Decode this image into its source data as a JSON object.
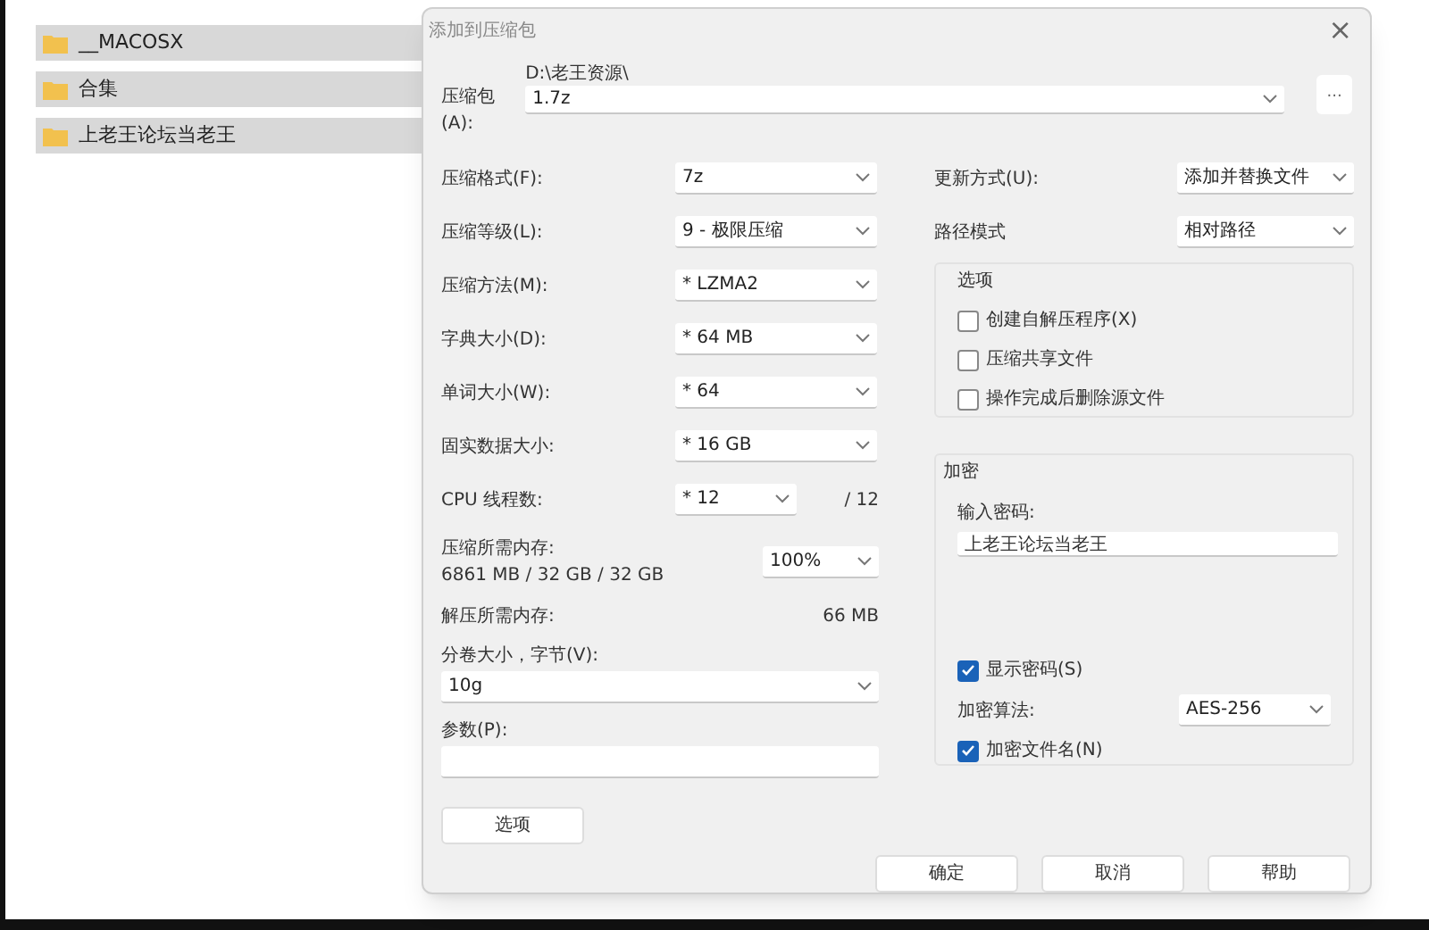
{
  "explorer": {
    "items": [
      {
        "name": "__MACOSX"
      },
      {
        "name": "合集"
      },
      {
        "name": "上老王论坛当老王"
      }
    ]
  },
  "window": {
    "title": "添加到压缩包",
    "close": "×"
  },
  "archive": {
    "label": "压缩包(A):",
    "path": "D:\\老王资源\\",
    "value": "1.7z",
    "browse": "..."
  },
  "settings": [
    {
      "label": "压缩格式(F):",
      "value": "7z"
    },
    {
      "label": "压缩等级(L):",
      "value": "9 - 极限压缩"
    },
    {
      "label": "压缩方法(M):",
      "value": "* LZMA2"
    },
    {
      "label": "字典大小(D):",
      "value": "* 64 MB"
    },
    {
      "label": "单词大小(W):",
      "value": "* 64"
    },
    {
      "label": "固实数据大小:",
      "value": "* 16 GB"
    },
    {
      "label": "CPU 线程数:",
      "value": "* 12",
      "suffix": "/ 12"
    }
  ],
  "memory": {
    "label": "压缩所需内存:",
    "detail": "6861 MB / 32 GB / 32 GB",
    "value": "100%"
  },
  "decompress": {
    "label": "解压所需内存:",
    "value": "66 MB"
  },
  "volume": {
    "label": "分卷大小，字节(V):",
    "value": "10g"
  },
  "params": {
    "label": "参数(P):"
  },
  "options_button": "选项",
  "update": {
    "label": "更新方式(U):",
    "value": "添加并替换文件"
  },
  "path_mode": {
    "label": "路径模式",
    "value": "相对路径"
  },
  "options": {
    "title": "选项",
    "checkboxes": [
      {
        "label": "创建自解压程序(X)",
        "checked": false
      },
      {
        "label": "压缩共享文件",
        "checked": false
      },
      {
        "label": "操作完成后删除源文件",
        "checked": false
      }
    ]
  },
  "encryption": {
    "title": "加密",
    "password_label": "输入密码:",
    "password": "上老王论坛当老王",
    "show_password": {
      "label": "显示密码(S)",
      "checked": true
    },
    "method": {
      "label": "加密算法:",
      "value": "AES-256"
    },
    "encrypt_names": {
      "label": "加密文件名(N)",
      "checked": true
    }
  },
  "buttons": [
    "确定",
    "取消",
    "帮助"
  ]
}
